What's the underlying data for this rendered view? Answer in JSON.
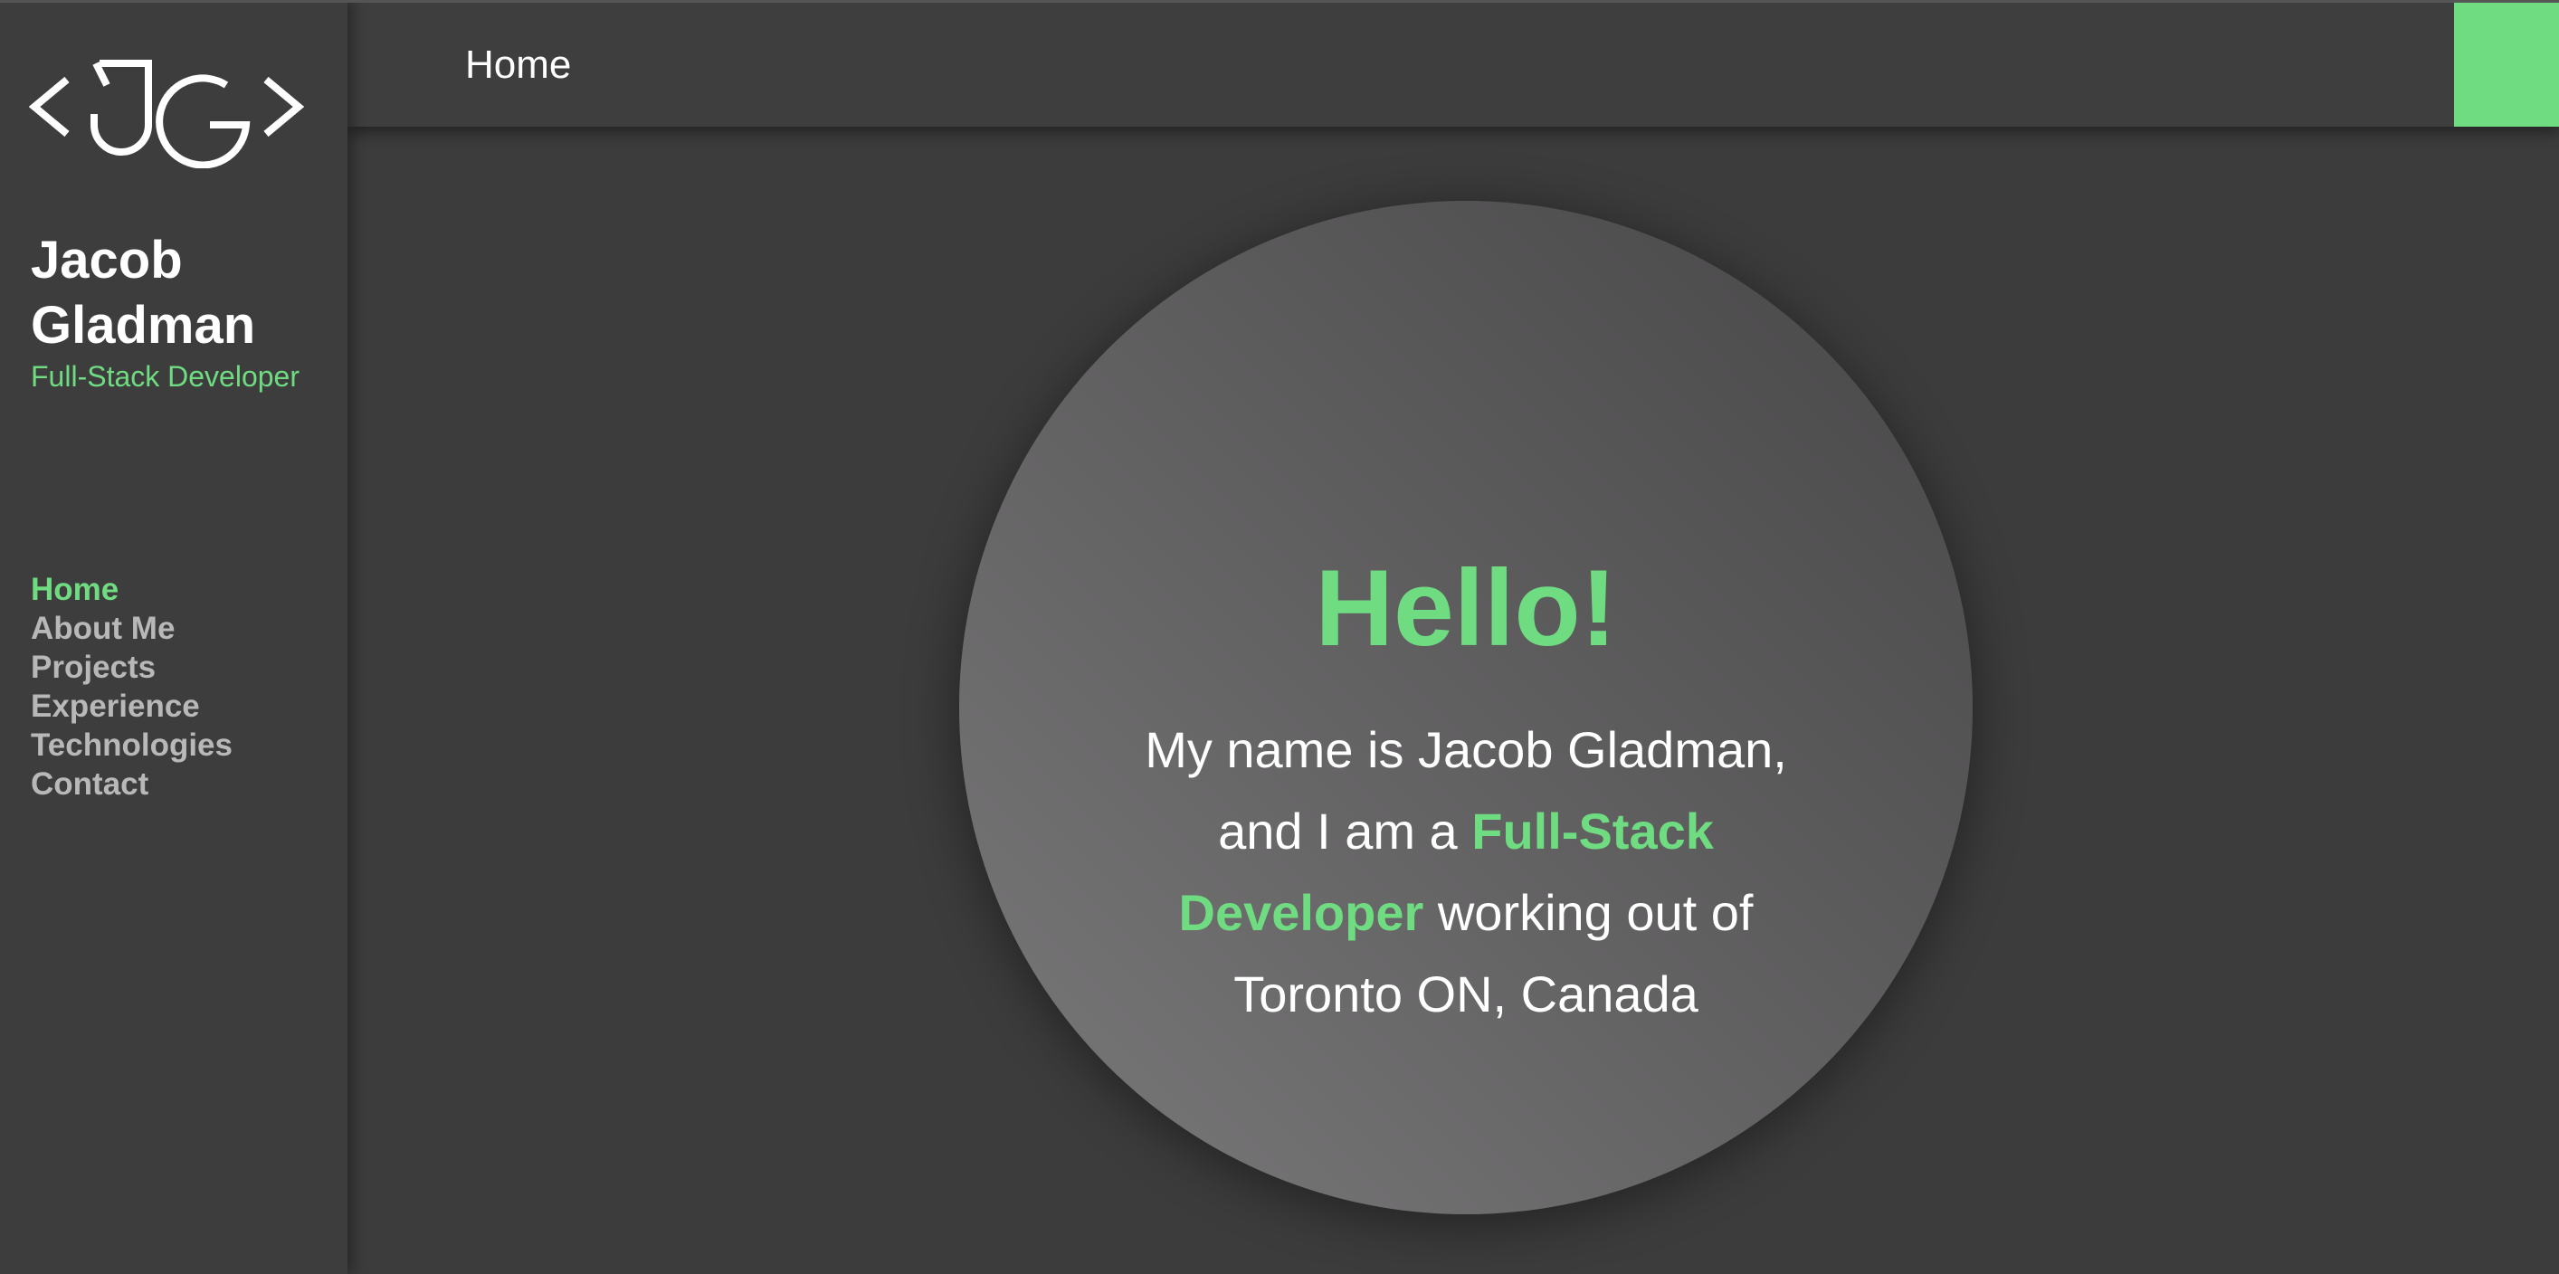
{
  "sidebar": {
    "logo_text": "JG",
    "name": "Jacob Gladman",
    "role": "Full-Stack Developer",
    "nav": [
      {
        "label": "Home",
        "active": true
      },
      {
        "label": "About Me",
        "active": false
      },
      {
        "label": "Projects",
        "active": false
      },
      {
        "label": "Experience",
        "active": false
      },
      {
        "label": "Technologies",
        "active": false
      },
      {
        "label": "Contact",
        "active": false
      }
    ]
  },
  "header": {
    "title": "Home"
  },
  "hero": {
    "greeting": "Hello!",
    "intro_part1": "My name is Jacob Gladman, and I am a ",
    "intro_highlight": "Full-Stack Developer",
    "intro_part2": " working out of Toronto ON, Canada"
  },
  "colors": {
    "accent": "#6fdc82",
    "background": "#3f3e3f",
    "text": "#ffffff",
    "nav_inactive": "#b9b8b9"
  }
}
